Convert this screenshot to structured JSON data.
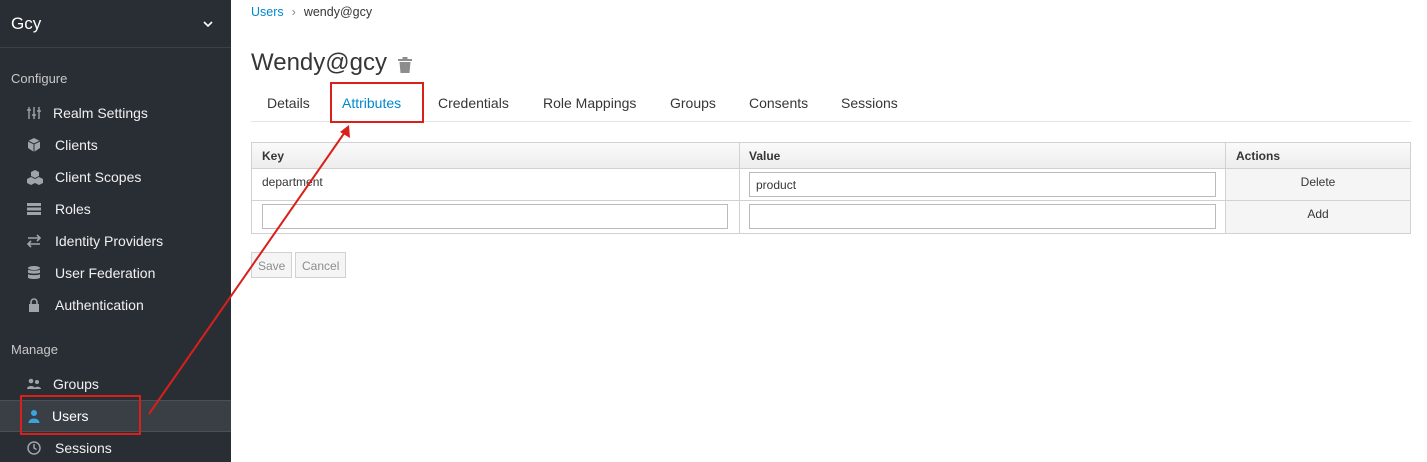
{
  "realm": {
    "name": "Gcy"
  },
  "sidebar": {
    "configure_label": "Configure",
    "manage_label": "Manage",
    "configure_items": [
      {
        "label": "Realm Settings",
        "icon": "sliders-icon"
      },
      {
        "label": "Clients",
        "icon": "cube-icon"
      },
      {
        "label": "Client Scopes",
        "icon": "cubes-icon"
      },
      {
        "label": "Roles",
        "icon": "list-icon"
      },
      {
        "label": "Identity Providers",
        "icon": "exchange-icon"
      },
      {
        "label": "User Federation",
        "icon": "database-icon"
      },
      {
        "label": "Authentication",
        "icon": "lock-icon"
      }
    ],
    "manage_items": [
      {
        "label": "Groups",
        "icon": "users-icon"
      },
      {
        "label": "Users",
        "icon": "user-icon",
        "active": true
      },
      {
        "label": "Sessions",
        "icon": "clock-icon"
      }
    ]
  },
  "breadcrumb": {
    "parent": "Users",
    "separator": "›",
    "current": "wendy@gcy"
  },
  "page": {
    "title": "Wendy@gcy"
  },
  "tabs": [
    "Details",
    "Attributes",
    "Credentials",
    "Role Mappings",
    "Groups",
    "Consents",
    "Sessions"
  ],
  "active_tab": "Attributes",
  "table": {
    "headers": {
      "key": "Key",
      "value": "Value",
      "actions": "Actions"
    },
    "rows": [
      {
        "key": "department",
        "value": "product",
        "action": "Delete"
      }
    ],
    "new_row": {
      "key": "",
      "value": "",
      "action": "Add"
    }
  },
  "buttons": {
    "save": "Save",
    "cancel": "Cancel"
  },
  "colors": {
    "sidebar_bg": "#292e34",
    "accent": "#0088ce",
    "annotation": "#d9201b"
  }
}
